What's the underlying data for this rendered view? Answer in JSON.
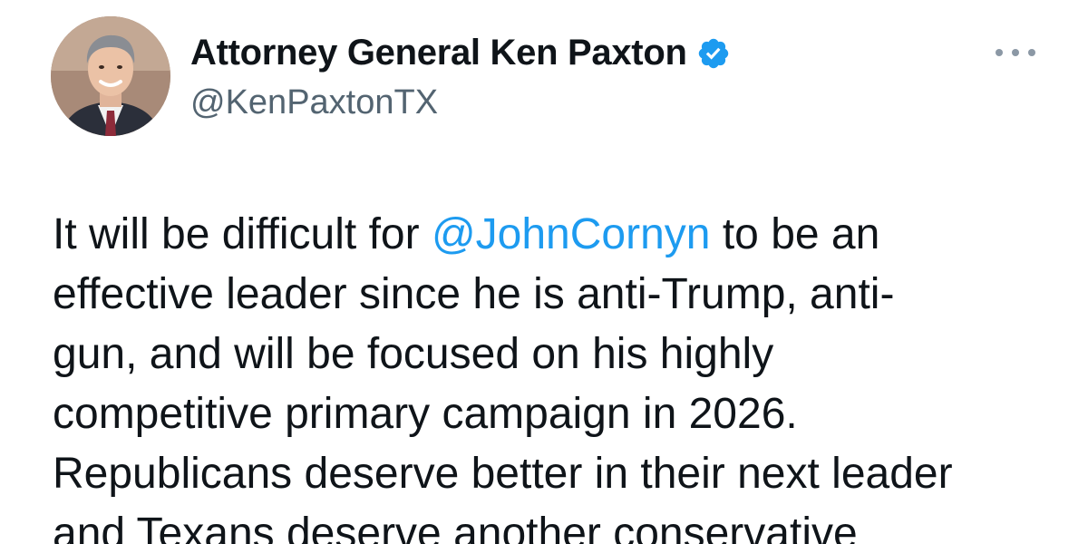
{
  "author": {
    "display_name": "Attorney General Ken Paxton",
    "handle": "@KenPaxtonTX",
    "verified": true,
    "avatar_icon": "profile-photo"
  },
  "colors": {
    "text": "#0f1419",
    "secondary_text": "#536471",
    "link": "#1d9bf0",
    "verified_badge": "#1d9bf0",
    "more_icon": "#8b98a5"
  },
  "more_menu_icon": "ellipsis-icon",
  "tweet": {
    "lines": [
      {
        "before": "It will be difficult for ",
        "mention": "@JohnCornyn",
        "after": " to be an"
      },
      {
        "text": "effective leader since he is anti-Trump, anti-"
      },
      {
        "text": "gun, and will be focused on his highly"
      },
      {
        "text": "competitive primary campaign in 2026."
      },
      {
        "text": "Republicans deserve better in their next leader"
      },
      {
        "text": "and Texans deserve another conservative"
      }
    ]
  }
}
